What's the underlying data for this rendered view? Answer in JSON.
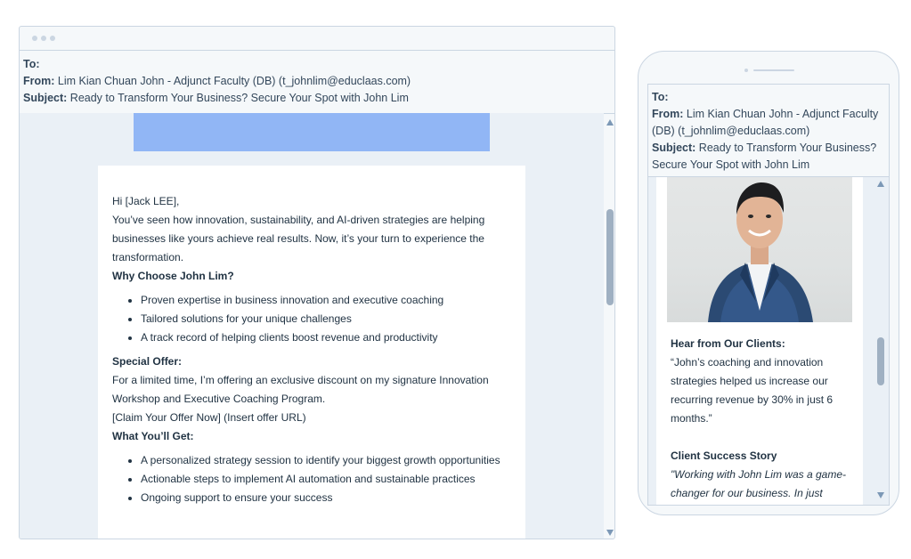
{
  "desktop": {
    "to_label": "To:",
    "to_value": "",
    "from_label": "From:",
    "from_value": "Lim Kian Chuan John - Adjunct Faculty (DB) (t_johnlim@educlaas.com)",
    "subject_label": "Subject:",
    "subject_value": "Ready to Transform Your Business? Secure Your Spot with John Lim"
  },
  "email": {
    "greeting": "Hi [Jack LEE],",
    "intro": "You’ve seen how innovation, sustainability, and AI-driven strategies are helping businesses like yours achieve real results. Now, it’s your turn to experience the transformation.",
    "why_heading": "Why Choose John Lim?",
    "why_items": [
      "Proven expertise in business innovation and executive coaching",
      "Tailored solutions for your unique challenges",
      "A track record of helping clients boost revenue and productivity"
    ],
    "offer_heading": "Special Offer:",
    "offer_text": "For a limited time, I’m offering an exclusive discount on my signature Innovation Workshop and Executive Coaching Program.",
    "offer_link": "[Claim Your Offer Now] (Insert offer URL)",
    "get_heading": "What You’ll Get:",
    "get_items": [
      "A personalized strategy session to identify your biggest growth opportunities",
      "Actionable steps to implement AI automation and sustainable practices",
      "Ongoing support to ensure your success"
    ]
  },
  "mobile": {
    "to_label": "To:",
    "from_label": "From:",
    "from_value": "Lim Kian Chuan John - Adjunct Faculty (DB) (t_johnlim@educlaas.com)",
    "subject_label": "Subject:",
    "subject_value": "Ready to Transform Your Business? Secure Your Spot with John Lim",
    "clients_heading": "Hear from Our Clients:",
    "clients_quote": "“John’s coaching and innovation strategies helped us increase our recurring revenue by 30% in just 6 months.”",
    "story_heading": "Client Success Story",
    "story_quote": "\"Working with John Lim was a game-changer for our business. In just three"
  },
  "colors": {
    "banner": "#91b6f5",
    "panel_bg": "#eaf0f6",
    "text": "#213343"
  }
}
